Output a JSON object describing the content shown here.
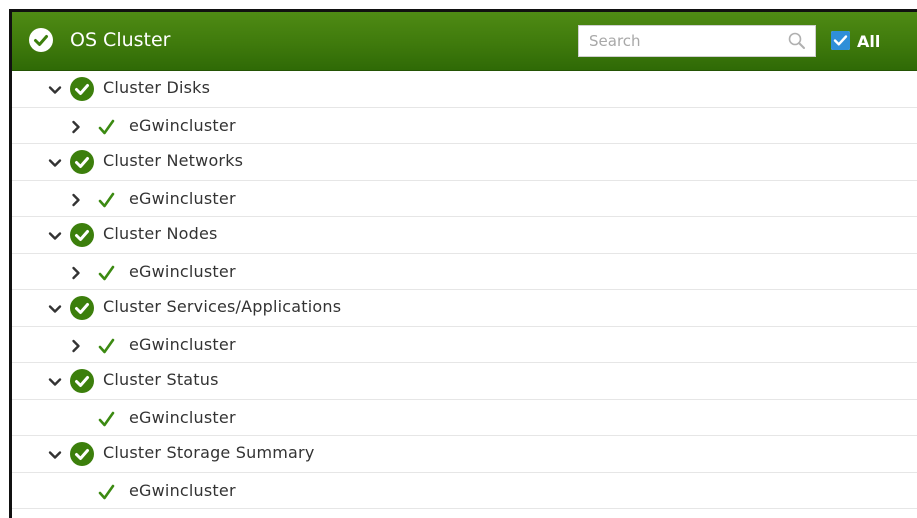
{
  "header": {
    "title": "OS Cluster",
    "search_placeholder": "Search",
    "all_label": "All",
    "all_checked": true
  },
  "tree": {
    "groups": [
      {
        "label": "Cluster Disks",
        "expanded": true,
        "children": [
          {
            "label": "eGwincluster",
            "expandable": true
          }
        ]
      },
      {
        "label": "Cluster Networks",
        "expanded": true,
        "children": [
          {
            "label": "eGwincluster",
            "expandable": true
          }
        ]
      },
      {
        "label": "Cluster Nodes",
        "expanded": true,
        "children": [
          {
            "label": "eGwincluster",
            "expandable": true
          }
        ]
      },
      {
        "label": "Cluster Services/Applications",
        "expanded": true,
        "children": [
          {
            "label": "eGwincluster",
            "expandable": true
          }
        ]
      },
      {
        "label": "Cluster Status",
        "expanded": true,
        "children": [
          {
            "label": "eGwincluster",
            "expandable": false
          }
        ]
      },
      {
        "label": "Cluster Storage Summary",
        "expanded": true,
        "children": [
          {
            "label": "eGwincluster",
            "expandable": false
          }
        ]
      }
    ]
  },
  "colors": {
    "header_green": "#3f7a0c",
    "status_ok": "#3c7f0c",
    "checkbox_blue": "#2f8fd8"
  },
  "icons": {
    "header_status": "check-circle-icon",
    "search": "search-icon",
    "expand": "chevron-down-icon",
    "collapse": "chevron-right-icon",
    "child_status": "check-mark-icon"
  }
}
